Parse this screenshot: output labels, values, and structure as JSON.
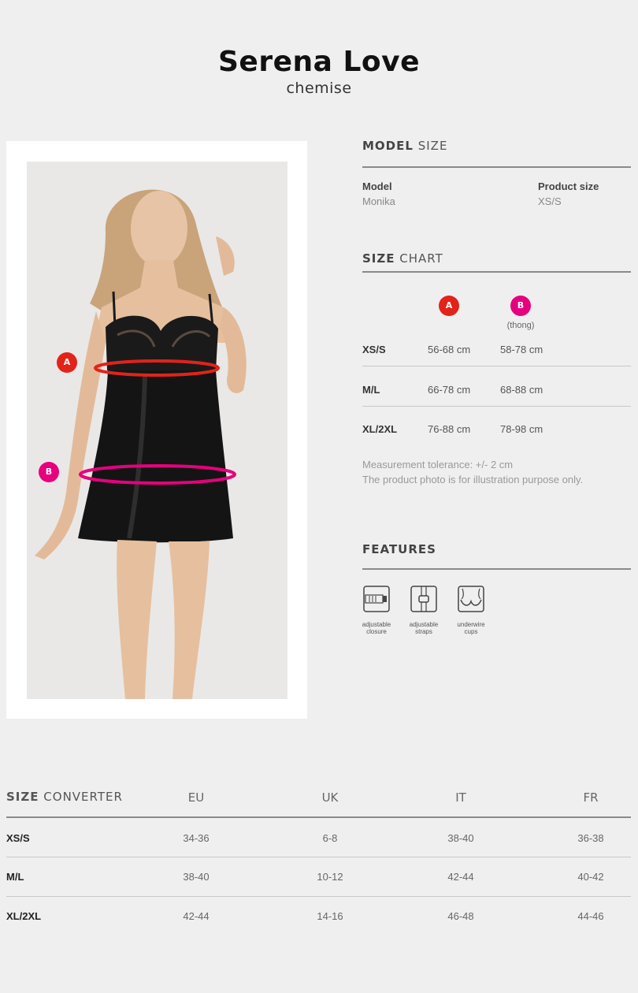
{
  "product": {
    "name": "Serena Love",
    "type": "chemise"
  },
  "model_size": {
    "heading_bold": "MODEL",
    "heading_light": "SIZE",
    "model_label": "Model",
    "model_value": "Monika",
    "product_size_label": "Product size",
    "product_size_value": "XS/S"
  },
  "size_chart": {
    "heading_bold": "SIZE",
    "heading_light": "CHART",
    "markers": [
      {
        "letter": "A",
        "color": "#e2231a",
        "note": ""
      },
      {
        "letter": "B",
        "color": "#e6007e",
        "note": "(thong)"
      }
    ],
    "rows": [
      {
        "size": "XS/S",
        "a": "56-68 cm",
        "b": "58-78 cm"
      },
      {
        "size": "M/L",
        "a": "66-78 cm",
        "b": "68-88 cm"
      },
      {
        "size": "XL/2XL",
        "a": "76-88 cm",
        "b": "78-98 cm"
      }
    ],
    "note_1": "Measurement tolerance: +/- 2 cm",
    "note_2": "The product photo is for illustration purpose only."
  },
  "features": {
    "heading": "FEATURES",
    "items": [
      {
        "icon": "adjustable-closure-icon",
        "line1": "adjustable",
        "line2": "closure"
      },
      {
        "icon": "adjustable-straps-icon",
        "line1": "adjustable",
        "line2": "straps"
      },
      {
        "icon": "underwire-cups-icon",
        "line1": "underwire",
        "line2": "cups"
      }
    ]
  },
  "photo_markers": {
    "a": "A",
    "b": "B"
  },
  "converter": {
    "heading_bold": "SIZE",
    "heading_light": "CONVERTER",
    "columns": [
      "EU",
      "UK",
      "IT",
      "FR"
    ],
    "rows": [
      {
        "size": "XS/S",
        "values": [
          "34-36",
          "6-8",
          "38-40",
          "36-38"
        ]
      },
      {
        "size": "M/L",
        "values": [
          "38-40",
          "10-12",
          "42-44",
          "40-42"
        ]
      },
      {
        "size": "XL/2XL",
        "values": [
          "42-44",
          "14-16",
          "46-48",
          "44-46"
        ]
      }
    ]
  },
  "colors": {
    "marker_a": "#e2231a",
    "marker_b": "#e6007e",
    "background": "#efefef"
  }
}
